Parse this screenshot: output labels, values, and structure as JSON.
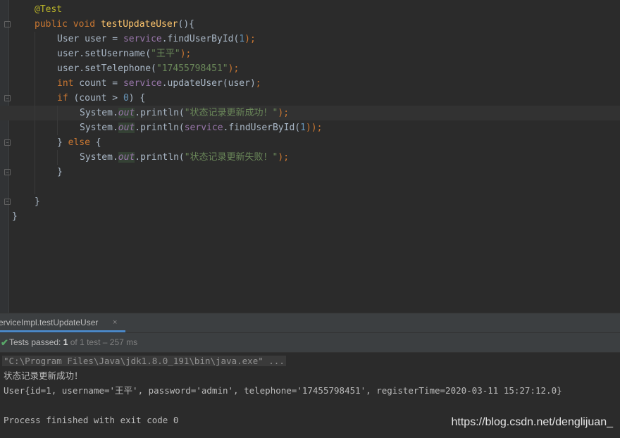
{
  "editor": {
    "code": {
      "annotation": "@Test",
      "method_public": "public",
      "method_void": "void",
      "method_name": "testUpdateUser",
      "method_paren": "(){",
      "l3_type": "User",
      "l3_var": " user = ",
      "l3_field": "service",
      "l3_call": ".findUserById(",
      "l3_num": "1",
      "l3_end": ");",
      "l4_call": "user.setUsername(",
      "l4_str": "\"王平\"",
      "l4_end": ");",
      "l5_call": "user.setTelephone(",
      "l5_str": "\"17455798451\"",
      "l5_end": ");",
      "l6_kw": "int",
      "l6_var": " count = ",
      "l6_field": "service",
      "l6_call": ".updateUser(user)",
      "l6_end": ";",
      "l7_kw": "if",
      "l7_cond": " (count > ",
      "l7_num": "0",
      "l7_end": ") {",
      "l8_sys": "System.",
      "l8_out": "out",
      "l8_call": ".println(",
      "l8_str": "\"状态记录更新成功！\"",
      "l8_end": ");",
      "l9_sys": "System.",
      "l9_out": "out",
      "l9_call": ".println(",
      "l9_field": "service",
      "l9_call2": ".findUserById(",
      "l9_num": "1",
      "l9_end": "));",
      "l10_close": "} ",
      "l10_kw": "else",
      "l10_end": " {",
      "l11_sys": "System.",
      "l11_out": "out",
      "l11_call": ".println(",
      "l11_str": "\"状态记录更新失败！\"",
      "l11_end": ");",
      "l12_close": "}",
      "l14_close": "}",
      "l15_close": "}"
    }
  },
  "run_panel": {
    "tab_label": "erviceImpl.testUpdateUser",
    "tab_close": "×",
    "status_check": "✔",
    "status_label": "Tests passed: ",
    "status_count": "1",
    "status_detail": " of 1 test – 257 ms",
    "console": [
      "\"C:\\Program Files\\Java\\jdk1.8.0_191\\bin\\java.exe\" ...",
      "状态记录更新成功！",
      "User{id=1, username='王平', password='admin', telephone='17455798451', registerTime=2020-03-11 15:27:12.0}",
      "Process finished with exit code 0"
    ]
  },
  "watermark": "https://blog.csdn.net/denglijuan_",
  "colors": {
    "background": "#2b2b2b",
    "keyword": "#cc7832",
    "annotation": "#bbb529",
    "method": "#ffc66d",
    "number": "#6897bb",
    "string": "#6a8759",
    "field": "#9876aa",
    "pass": "#59a869"
  }
}
